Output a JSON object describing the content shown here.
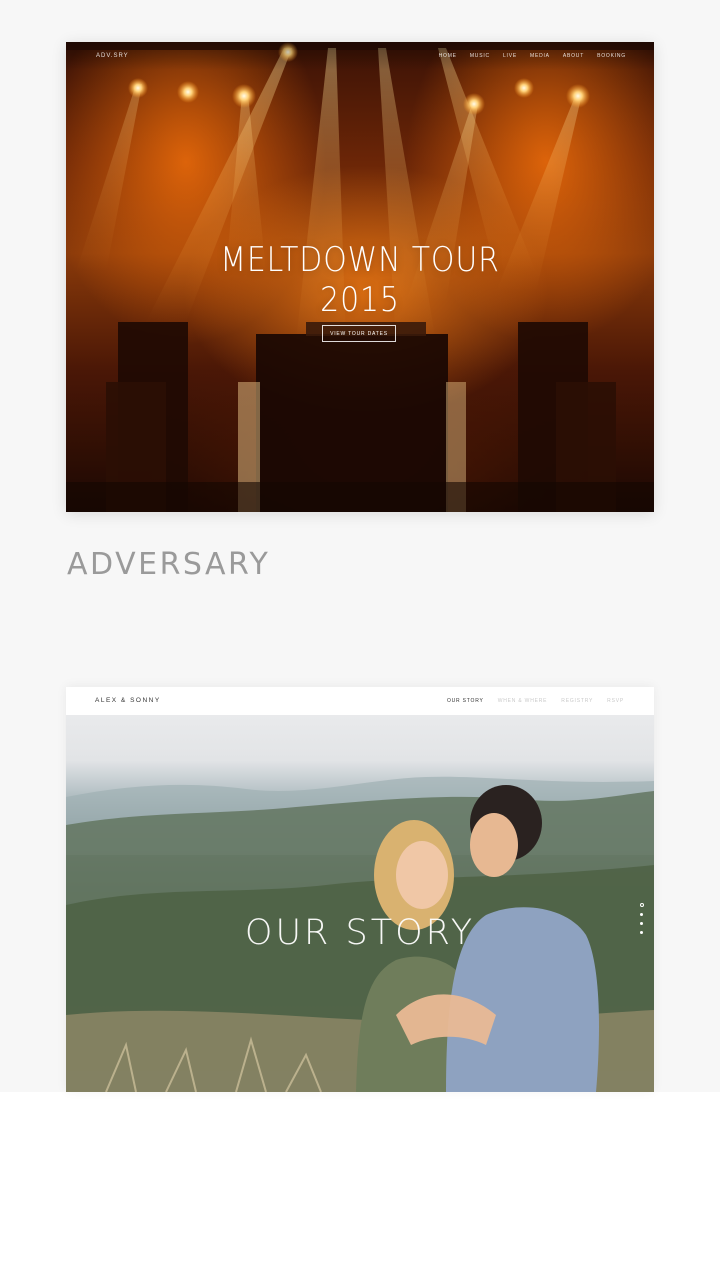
{
  "sites": [
    {
      "name": "ADVERSARY",
      "preview": {
        "brand": "ADV.SRY",
        "nav": [
          "HOME",
          "MUSIC",
          "LIVE",
          "MEDIA",
          "ABOUT",
          "BOOKING"
        ],
        "hero_title_line1": "MELTDOWN TOUR",
        "hero_title_line2": "2015",
        "cta_label": "VIEW TOUR DATES"
      }
    },
    {
      "preview": {
        "brand": "ALEX & SONNY",
        "nav": [
          "OUR STORY",
          "WHEN & WHERE",
          "REGISTRY",
          "RSVP"
        ],
        "active_nav": "OUR STORY",
        "hero_title": "OUR STORY"
      }
    }
  ],
  "colors": {
    "page_background": "#f7f7f7",
    "label_gray": "#9a9a9a",
    "stage_orange": "#eb7814"
  }
}
